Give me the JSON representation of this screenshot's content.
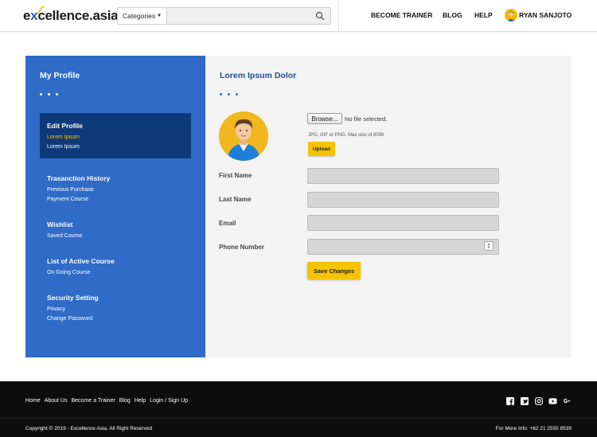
{
  "header": {
    "logo": {
      "prefix": "e",
      "x": "x",
      "rest": "cellence.asia"
    },
    "search": {
      "category_label": "Categories",
      "placeholder": ""
    },
    "nav": {
      "become_trainer": "BECOME TRAINER",
      "blog": "BLOG",
      "help": "HELP"
    },
    "user": {
      "name": "RYAN SANJOTO"
    }
  },
  "sidebar": {
    "title": "My Profile",
    "groups": [
      {
        "heading": "Edit Profile",
        "links": [
          "Lorem Ipsum",
          "Lorem Ipsum"
        ]
      },
      {
        "heading": "Trasanction History",
        "links": [
          "Previous Purchase",
          "Payment Course"
        ]
      },
      {
        "heading": "Wishlist",
        "links": [
          "Saved Course"
        ]
      },
      {
        "heading": "List of Active Course",
        "links": [
          "On Going Course"
        ]
      },
      {
        "heading": "Security Setting",
        "links": [
          "Privacy",
          "Change Password"
        ]
      }
    ]
  },
  "content": {
    "title": "Lorem Ipsum Dolor",
    "browse_label": "Browse...",
    "file_status": "No file selected.",
    "file_hint": "JPG, GIF or PNG. Max size of 800K",
    "upload_label": "Upload",
    "fields": [
      {
        "label": "First Name",
        "value": ""
      },
      {
        "label": "Last Name",
        "value": ""
      },
      {
        "label": "Email",
        "value": ""
      },
      {
        "label": "Phone Number",
        "value": ""
      }
    ],
    "save_label": "Save Changes"
  },
  "footer": {
    "links": [
      "Home",
      "About Us",
      "Become a Trainer",
      "Blog",
      "Help",
      "Login / Sign Up"
    ],
    "copyright": "Copyright © 2019 - Excellence Asia. All Right Reserved",
    "contact": "For More Info: +62 21 2555 8539",
    "social_icons": [
      "facebook-icon",
      "twitter-icon",
      "instagram-icon",
      "youtube-icon",
      "google-plus-icon"
    ]
  },
  "colors": {
    "primary": "#2f6bc7",
    "active": "#0f3a7a",
    "accent": "#f5c400",
    "footer": "#0d0d0d"
  }
}
